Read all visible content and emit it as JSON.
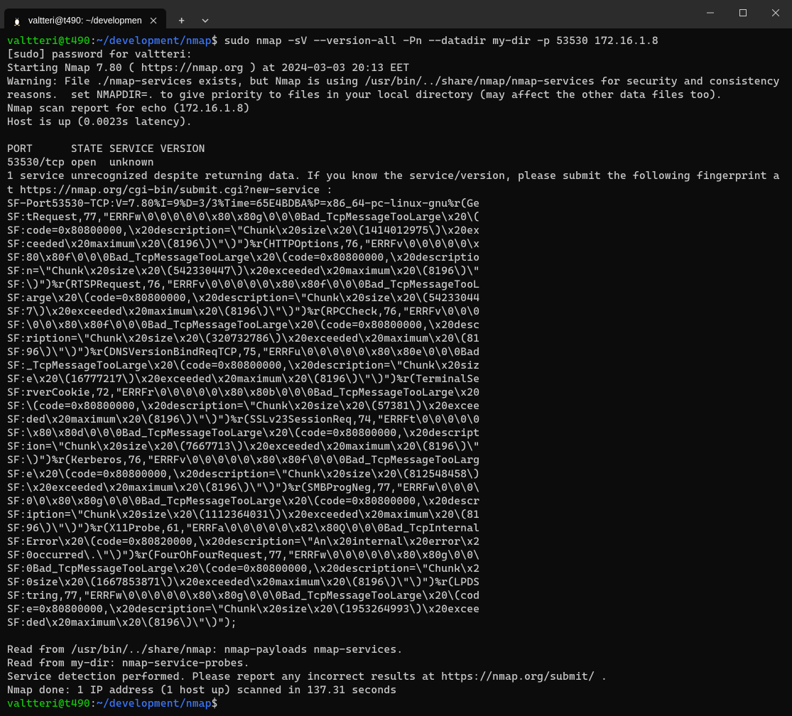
{
  "titlebar": {
    "tab_title": "valtteri@t490: ~/developmen",
    "new_tab_label": "+",
    "dropdown_label": "⌵"
  },
  "prompt": {
    "user_host": "valtteri@t490",
    "sep": ":",
    "path": "~/development/nmap",
    "dollar": "$"
  },
  "command": " sudo nmap -sV --version-all -Pn --datadir my-dir -p 53530 172.16.1.8",
  "output_lines": [
    "[sudo] password for valtteri:",
    "Starting Nmap 7.80 ( https://nmap.org ) at 2024-03-03 20:13 EET",
    "Warning: File ./nmap-services exists, but Nmap is using /usr/bin/../share/nmap/nmap-services for security and consistency reasons.  set NMAPDIR=. to give priority to files in your local directory (may affect the other data files too).",
    "Nmap scan report for echo (172.16.1.8)",
    "Host is up (0.0023s latency).",
    "",
    "PORT      STATE SERVICE VERSION",
    "53530/tcp open  unknown",
    "1 service unrecognized despite returning data. If you know the service/version, please submit the following fingerprint at https://nmap.org/cgi-bin/submit.cgi?new-service :",
    "SF-Port53530-TCP:V=7.80%I=9%D=3/3%Time=65E4BDBA%P=x86_64-pc-linux-gnu%r(Ge",
    "SF:tRequest,77,\"ERRFw\\0\\0\\0\\0\\0\\x80\\x80g\\0\\0\\0Bad_TcpMessageTooLarge\\x20\\(",
    "SF:code=0x80800000,\\x20description=\\\"Chunk\\x20size\\x20\\(1414012975\\)\\x20ex",
    "SF:ceeded\\x20maximum\\x20\\(8196\\)\\\"\\)\")%r(HTTPOptions,76,\"ERRFv\\0\\0\\0\\0\\0\\x",
    "SF:80\\x80f\\0\\0\\0Bad_TcpMessageTooLarge\\x20\\(code=0x80800000,\\x20descriptio",
    "SF:n=\\\"Chunk\\x20size\\x20\\(542330447\\)\\x20exceeded\\x20maximum\\x20\\(8196\\)\\\"",
    "SF:\\)\")%r(RTSPRequest,76,\"ERRFv\\0\\0\\0\\0\\0\\x80\\x80f\\0\\0\\0Bad_TcpMessageTooL",
    "SF:arge\\x20\\(code=0x80800000,\\x20description=\\\"Chunk\\x20size\\x20\\(54233044",
    "SF:7\\)\\x20exceeded\\x20maximum\\x20\\(8196\\)\\\"\\)\")%r(RPCCheck,76,\"ERRFv\\0\\0\\0",
    "SF:\\0\\0\\x80\\x80f\\0\\0\\0Bad_TcpMessageTooLarge\\x20\\(code=0x80800000,\\x20desc",
    "SF:ription=\\\"Chunk\\x20size\\x20\\(320732786\\)\\x20exceeded\\x20maximum\\x20\\(81",
    "SF:96\\)\\\"\\)\")%r(DNSVersionBindReqTCP,75,\"ERRFu\\0\\0\\0\\0\\0\\x80\\x80e\\0\\0\\0Bad",
    "SF:_TcpMessageTooLarge\\x20\\(code=0x80800000,\\x20description=\\\"Chunk\\x20siz",
    "SF:e\\x20\\(16777217\\)\\x20exceeded\\x20maximum\\x20\\(8196\\)\\\"\\)\")%r(TerminalSe",
    "SF:rverCookie,72,\"ERRFr\\0\\0\\0\\0\\0\\x80\\x80b\\0\\0\\0Bad_TcpMessageTooLarge\\x20",
    "SF:\\(code=0x80800000,\\x20description=\\\"Chunk\\x20size\\x20\\(57381\\)\\x20excee",
    "SF:ded\\x20maximum\\x20\\(8196\\)\\\"\\)\")%r(SSLv23SessionReq,74,\"ERRFt\\0\\0\\0\\0\\0",
    "SF:\\x80\\x80d\\0\\0\\0Bad_TcpMessageTooLarge\\x20\\(code=0x80800000,\\x20descript",
    "SF:ion=\\\"Chunk\\x20size\\x20\\(7667713\\)\\x20exceeded\\x20maximum\\x20\\(8196\\)\\\"",
    "SF:\\)\")%r(Kerberos,76,\"ERRFv\\0\\0\\0\\0\\0\\x80\\x80f\\0\\0\\0Bad_TcpMessageTooLarg",
    "SF:e\\x20\\(code=0x80800000,\\x20description=\\\"Chunk\\x20size\\x20\\(812548458\\)",
    "SF:\\x20exceeded\\x20maximum\\x20\\(8196\\)\\\"\\)\")%r(SMBProgNeg,77,\"ERRFw\\0\\0\\0\\",
    "SF:0\\0\\x80\\x80g\\0\\0\\0Bad_TcpMessageTooLarge\\x20\\(code=0x80800000,\\x20descr",
    "SF:iption=\\\"Chunk\\x20size\\x20\\(1112364031\\)\\x20exceeded\\x20maximum\\x20\\(81",
    "SF:96\\)\\\"\\)\")%r(X11Probe,61,\"ERRFa\\0\\0\\0\\0\\0\\x82\\x80Q\\0\\0\\0Bad_TcpInternal",
    "SF:Error\\x20\\(code=0x80820000,\\x20description=\\\"An\\x20internal\\x20error\\x2",
    "SF:0occurred\\.\\\"\\)\")%r(FourOhFourRequest,77,\"ERRFw\\0\\0\\0\\0\\0\\x80\\x80g\\0\\0\\",
    "SF:0Bad_TcpMessageTooLarge\\x20\\(code=0x80800000,\\x20description=\\\"Chunk\\x2",
    "SF:0size\\x20\\(1667853871\\)\\x20exceeded\\x20maximum\\x20\\(8196\\)\\\"\\)\")%r(LPDS",
    "SF:tring,77,\"ERRFw\\0\\0\\0\\0\\0\\x80\\x80g\\0\\0\\0Bad_TcpMessageTooLarge\\x20\\(cod",
    "SF:e=0x80800000,\\x20description=\\\"Chunk\\x20size\\x20\\(1953264993\\)\\x20excee",
    "SF:ded\\x20maximum\\x20\\(8196\\)\\\"\\)\");",
    "",
    "Read from /usr/bin/../share/nmap: nmap-payloads nmap-services.",
    "Read from my-dir: nmap-service-probes.",
    "Service detection performed. Please report any incorrect results at https://nmap.org/submit/ .",
    "Nmap done: 1 IP address (1 host up) scanned in 137.31 seconds"
  ]
}
